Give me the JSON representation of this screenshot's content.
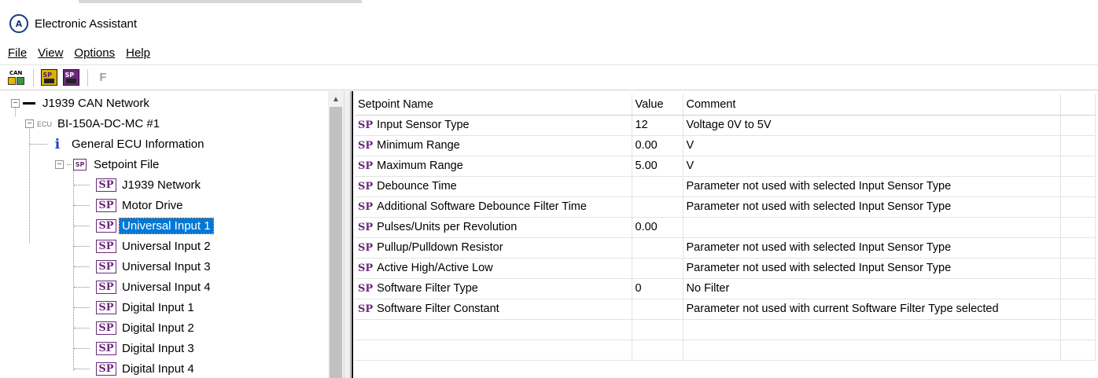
{
  "window": {
    "title": "Electronic Assistant"
  },
  "menu": {
    "file": "File",
    "view": "View",
    "options": "Options",
    "help": "Help"
  },
  "toolbar": {
    "f_label": "F",
    "can_label": "CAN",
    "sp_label": "SP"
  },
  "tree": {
    "network": "J1939 CAN Network",
    "ecu_prefix": "ECU",
    "ecu": "BI-150A-DC-MC #1",
    "general_info": "General ECU Information",
    "setpoint_file": "Setpoint File",
    "sp_icon_label": "SP",
    "items": [
      "J1939 Network",
      "Motor Drive",
      "Universal Input 1",
      "Universal Input 2",
      "Universal Input 3",
      "Universal Input 4",
      "Digital Input 1",
      "Digital Input 2",
      "Digital Input 3",
      "Digital Input 4"
    ],
    "selected": "Universal Input 1"
  },
  "grid": {
    "headers": {
      "name": "Setpoint Name",
      "value": "Value",
      "comment": "Comment"
    },
    "sp_tag": "SP",
    "rows": [
      {
        "name": "Input Sensor Type",
        "value": "12",
        "comment": "Voltage 0V to 5V"
      },
      {
        "name": "Minimum Range",
        "value": "0.00",
        "comment": "V"
      },
      {
        "name": "Maximum Range",
        "value": "5.00",
        "comment": "V"
      },
      {
        "name": "Debounce Time",
        "value": "",
        "comment": "Parameter not used with selected Input Sensor Type"
      },
      {
        "name": "Additional Software Debounce Filter Time",
        "value": "",
        "comment": "Parameter not used with selected Input Sensor Type"
      },
      {
        "name": "Pulses/Units per Revolution",
        "value": "0.00",
        "comment": ""
      },
      {
        "name": "Pullup/Pulldown Resistor",
        "value": "",
        "comment": "Parameter not used with selected Input Sensor Type"
      },
      {
        "name": "Active High/Active Low",
        "value": "",
        "comment": "Parameter not used with selected Input Sensor Type"
      },
      {
        "name": "Software Filter Type",
        "value": "0",
        "comment": "No Filter"
      },
      {
        "name": "Software Filter Constant",
        "value": "",
        "comment": "Parameter not used with current Software Filter Type selected"
      }
    ]
  }
}
